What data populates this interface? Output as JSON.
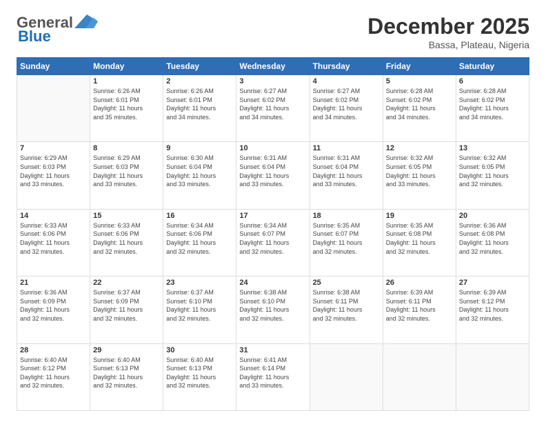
{
  "header": {
    "logo_general": "General",
    "logo_blue": "Blue",
    "month_title": "December 2025",
    "location": "Bassa, Plateau, Nigeria"
  },
  "days_of_week": [
    "Sunday",
    "Monday",
    "Tuesday",
    "Wednesday",
    "Thursday",
    "Friday",
    "Saturday"
  ],
  "weeks": [
    [
      {
        "num": "",
        "info": ""
      },
      {
        "num": "1",
        "info": "Sunrise: 6:26 AM\nSunset: 6:01 PM\nDaylight: 11 hours\nand 35 minutes."
      },
      {
        "num": "2",
        "info": "Sunrise: 6:26 AM\nSunset: 6:01 PM\nDaylight: 11 hours\nand 34 minutes."
      },
      {
        "num": "3",
        "info": "Sunrise: 6:27 AM\nSunset: 6:02 PM\nDaylight: 11 hours\nand 34 minutes."
      },
      {
        "num": "4",
        "info": "Sunrise: 6:27 AM\nSunset: 6:02 PM\nDaylight: 11 hours\nand 34 minutes."
      },
      {
        "num": "5",
        "info": "Sunrise: 6:28 AM\nSunset: 6:02 PM\nDaylight: 11 hours\nand 34 minutes."
      },
      {
        "num": "6",
        "info": "Sunrise: 6:28 AM\nSunset: 6:02 PM\nDaylight: 11 hours\nand 34 minutes."
      }
    ],
    [
      {
        "num": "7",
        "info": "Sunrise: 6:29 AM\nSunset: 6:03 PM\nDaylight: 11 hours\nand 33 minutes."
      },
      {
        "num": "8",
        "info": "Sunrise: 6:29 AM\nSunset: 6:03 PM\nDaylight: 11 hours\nand 33 minutes."
      },
      {
        "num": "9",
        "info": "Sunrise: 6:30 AM\nSunset: 6:04 PM\nDaylight: 11 hours\nand 33 minutes."
      },
      {
        "num": "10",
        "info": "Sunrise: 6:31 AM\nSunset: 6:04 PM\nDaylight: 11 hours\nand 33 minutes."
      },
      {
        "num": "11",
        "info": "Sunrise: 6:31 AM\nSunset: 6:04 PM\nDaylight: 11 hours\nand 33 minutes."
      },
      {
        "num": "12",
        "info": "Sunrise: 6:32 AM\nSunset: 6:05 PM\nDaylight: 11 hours\nand 33 minutes."
      },
      {
        "num": "13",
        "info": "Sunrise: 6:32 AM\nSunset: 6:05 PM\nDaylight: 11 hours\nand 32 minutes."
      }
    ],
    [
      {
        "num": "14",
        "info": "Sunrise: 6:33 AM\nSunset: 6:06 PM\nDaylight: 11 hours\nand 32 minutes."
      },
      {
        "num": "15",
        "info": "Sunrise: 6:33 AM\nSunset: 6:06 PM\nDaylight: 11 hours\nand 32 minutes."
      },
      {
        "num": "16",
        "info": "Sunrise: 6:34 AM\nSunset: 6:06 PM\nDaylight: 11 hours\nand 32 minutes."
      },
      {
        "num": "17",
        "info": "Sunrise: 6:34 AM\nSunset: 6:07 PM\nDaylight: 11 hours\nand 32 minutes."
      },
      {
        "num": "18",
        "info": "Sunrise: 6:35 AM\nSunset: 6:07 PM\nDaylight: 11 hours\nand 32 minutes."
      },
      {
        "num": "19",
        "info": "Sunrise: 6:35 AM\nSunset: 6:08 PM\nDaylight: 11 hours\nand 32 minutes."
      },
      {
        "num": "20",
        "info": "Sunrise: 6:36 AM\nSunset: 6:08 PM\nDaylight: 11 hours\nand 32 minutes."
      }
    ],
    [
      {
        "num": "21",
        "info": "Sunrise: 6:36 AM\nSunset: 6:09 PM\nDaylight: 11 hours\nand 32 minutes."
      },
      {
        "num": "22",
        "info": "Sunrise: 6:37 AM\nSunset: 6:09 PM\nDaylight: 11 hours\nand 32 minutes."
      },
      {
        "num": "23",
        "info": "Sunrise: 6:37 AM\nSunset: 6:10 PM\nDaylight: 11 hours\nand 32 minutes."
      },
      {
        "num": "24",
        "info": "Sunrise: 6:38 AM\nSunset: 6:10 PM\nDaylight: 11 hours\nand 32 minutes."
      },
      {
        "num": "25",
        "info": "Sunrise: 6:38 AM\nSunset: 6:11 PM\nDaylight: 11 hours\nand 32 minutes."
      },
      {
        "num": "26",
        "info": "Sunrise: 6:39 AM\nSunset: 6:11 PM\nDaylight: 11 hours\nand 32 minutes."
      },
      {
        "num": "27",
        "info": "Sunrise: 6:39 AM\nSunset: 6:12 PM\nDaylight: 11 hours\nand 32 minutes."
      }
    ],
    [
      {
        "num": "28",
        "info": "Sunrise: 6:40 AM\nSunset: 6:12 PM\nDaylight: 11 hours\nand 32 minutes."
      },
      {
        "num": "29",
        "info": "Sunrise: 6:40 AM\nSunset: 6:13 PM\nDaylight: 11 hours\nand 32 minutes."
      },
      {
        "num": "30",
        "info": "Sunrise: 6:40 AM\nSunset: 6:13 PM\nDaylight: 11 hours\nand 32 minutes."
      },
      {
        "num": "31",
        "info": "Sunrise: 6:41 AM\nSunset: 6:14 PM\nDaylight: 11 hours\nand 33 minutes."
      },
      {
        "num": "",
        "info": ""
      },
      {
        "num": "",
        "info": ""
      },
      {
        "num": "",
        "info": ""
      }
    ]
  ]
}
